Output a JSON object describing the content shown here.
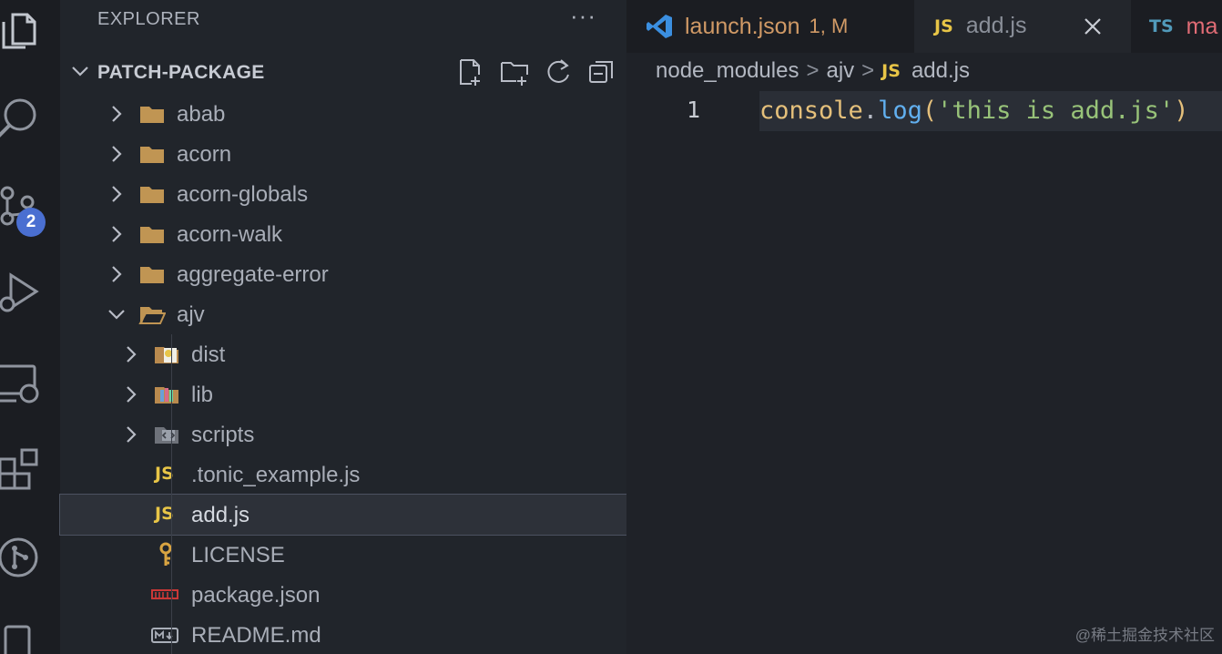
{
  "sidebar": {
    "title": "EXPLORER",
    "more": "···",
    "section_title": "PATCH-PACKAGE"
  },
  "activity": {
    "scm_badge": "2"
  },
  "tree": {
    "folders": [
      {
        "name": "abab"
      },
      {
        "name": "acorn"
      },
      {
        "name": "acorn-globals"
      },
      {
        "name": "acorn-walk"
      },
      {
        "name": "aggregate-error"
      },
      {
        "name": "ajv"
      }
    ],
    "children": [
      {
        "name": "dist"
      },
      {
        "name": "lib"
      },
      {
        "name": "scripts"
      },
      {
        "name": ".tonic_example.js",
        "badge": "JS"
      },
      {
        "name": "add.js",
        "badge": "JS"
      },
      {
        "name": "LICENSE"
      },
      {
        "name": "package.json"
      },
      {
        "name": "README.md"
      }
    ]
  },
  "tabs": [
    {
      "label": "launch.json",
      "decoration": "1, M",
      "color": "#d19a66"
    },
    {
      "label": "add.js",
      "badge": "JS",
      "color": "#8a8f99"
    },
    {
      "label": "ma",
      "badge": "TS",
      "color": "#e06c75"
    }
  ],
  "breadcrumb": {
    "part1": "node_modules",
    "part2": "ajv",
    "badge": "JS",
    "file": "add.js",
    "sep": ">"
  },
  "editor": {
    "line_number": "1",
    "tokens": {
      "obj": "console",
      "dot": ".",
      "fn": "log",
      "open": "(",
      "str": "'this is add.js'",
      "close": ")"
    }
  },
  "watermark": "@稀土掘金技术社区"
}
